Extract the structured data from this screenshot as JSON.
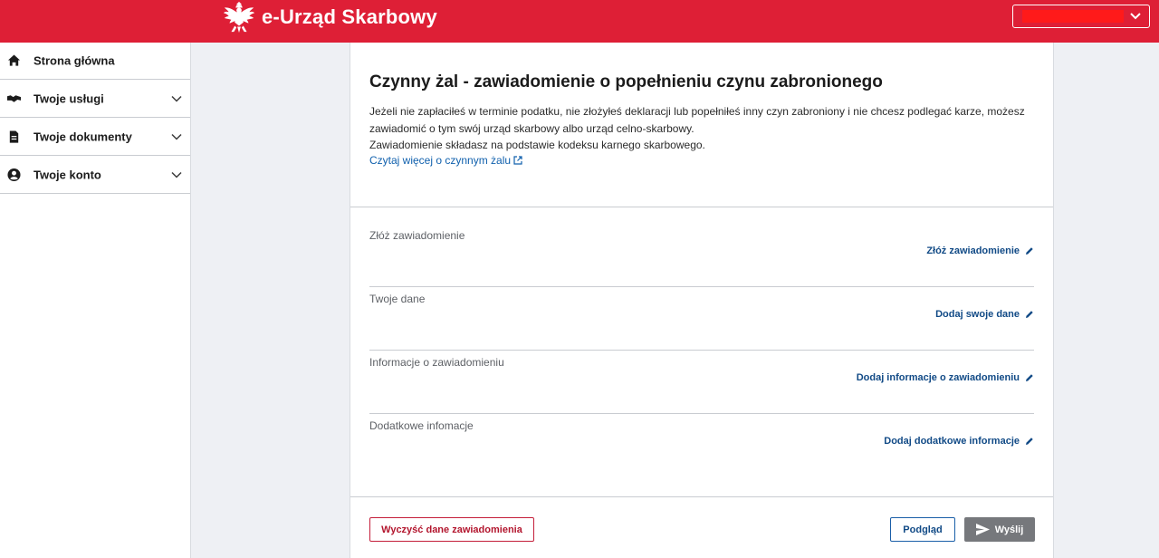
{
  "header": {
    "app_title": "e-Urząd Skarbowy",
    "brand_color": "#de1f36",
    "logo_icon": "polish-eagle-icon",
    "user_menu": {
      "name": "",
      "chevron_icon": "chevron-down-icon"
    }
  },
  "sidebar": {
    "items": [
      {
        "label": "Strona główna",
        "icon": "home-icon",
        "expandable": false
      },
      {
        "label": "Twoje usługi",
        "icon": "handshake-icon",
        "expandable": true
      },
      {
        "label": "Twoje dokumenty",
        "icon": "document-icon",
        "expandable": true
      },
      {
        "label": "Twoje konto",
        "icon": "user-circle-icon",
        "expandable": true
      }
    ]
  },
  "main": {
    "title": "Czynny żal - zawiadomienie o popełnieniu czynu zabronionego",
    "intro_line1": "Jeżeli nie zapłaciłeś w terminie podatku, nie złożyłeś deklaracji lub popełniłeś inny czyn zabroniony i nie chcesz podlegać karze, możesz zawiadomić o tym swój urząd skarbowy albo urząd celno-skarbowy.",
    "intro_line2": "Zawiadomienie składasz na podstawie kodeksu karnego skarbowego.",
    "more_link": "Czytaj więcej o czynnym żalu",
    "sections": [
      {
        "title": "Złóż zawiadomienie",
        "action": "Złóż zawiadomienie"
      },
      {
        "title": "Twoje dane",
        "action": "Dodaj swoje dane"
      },
      {
        "title": "Informacje o zawiadomieniu",
        "action": "Dodaj informacje o zawiadomieniu"
      },
      {
        "title": "Dodatkowe infomacje",
        "action": "Dodaj dodatkowe informacje"
      }
    ],
    "buttons": {
      "clear": "Wyczyść dane zawiadomienia",
      "preview": "Podgląd",
      "send": "Wyślij"
    }
  }
}
